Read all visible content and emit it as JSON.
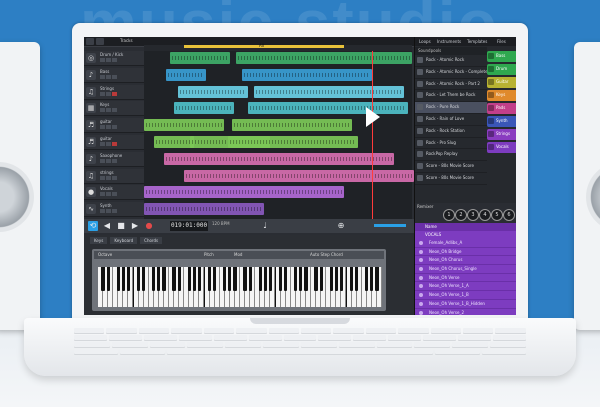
{
  "app": {
    "toolbar_label": "Tracks",
    "ruler_loop_label": "All",
    "tracks": [
      {
        "name": "Drum / Kick",
        "icon": "drums-icon"
      },
      {
        "name": "Bass",
        "icon": "bass-icon"
      },
      {
        "name": "Strings",
        "icon": "strings-icon"
      },
      {
        "name": "Keys",
        "icon": "keys-icon"
      },
      {
        "name": "guitar",
        "icon": "guitar-icon"
      },
      {
        "name": "guitar",
        "icon": "guitar-icon"
      },
      {
        "name": "Saxophone",
        "icon": "sax-icon"
      },
      {
        "name": "strings",
        "icon": "strings-icon"
      },
      {
        "name": "Vocals",
        "icon": "mic-icon"
      },
      {
        "name": "Synth",
        "icon": "synth-icon"
      }
    ]
  },
  "transport": {
    "time": "019:01:000",
    "bpm": "120 BPM"
  },
  "keyboard_panel": {
    "tabs": [
      "Keys",
      "Keyboard",
      "Chords"
    ],
    "controls": [
      "Octave",
      "Pitch",
      "Mod",
      "Auto Step Chord"
    ]
  },
  "sidebar": {
    "tabs": [
      "Loops",
      "Instruments",
      "Templates",
      "Files"
    ],
    "list_header": "Soundpools",
    "items": [
      {
        "label": "Rock - Atomic Rock",
        "selected": false
      },
      {
        "label": "Rock - Atomic Rock - Complete",
        "selected": false
      },
      {
        "label": "Rock - Atomic Rock - Part 2",
        "selected": false
      },
      {
        "label": "Rock - Let Them be Rock",
        "selected": false
      },
      {
        "label": "Rock - Pure Rock",
        "selected": true
      },
      {
        "label": "Rock - Rain of Love",
        "selected": false
      },
      {
        "label": "Rock - Rock Station",
        "selected": false
      },
      {
        "label": "Rock - Pro Slug",
        "selected": false
      },
      {
        "label": "RockPop Replay",
        "selected": false
      },
      {
        "label": "Score - 80s Movie Score",
        "selected": false
      },
      {
        "label": "Score - 80s Movie Score",
        "selected": false
      }
    ],
    "categories": [
      {
        "label": "Bass",
        "color": "#2fa84f"
      },
      {
        "label": "Drum",
        "color": "#2fa84f"
      },
      {
        "label": "Guitar",
        "color": "#b8b232"
      },
      {
        "label": "Keys",
        "color": "#e08a2c"
      },
      {
        "label": "Pads",
        "color": "#c23f8a"
      },
      {
        "label": "Synth",
        "color": "#3a56b8"
      },
      {
        "label": "Strings",
        "color": "#8a3cc0"
      },
      {
        "label": "Vocals",
        "color": "#7d3cc0"
      }
    ],
    "remix": {
      "title": "Remixer",
      "knobs": [
        "1",
        "2",
        "3",
        "4",
        "5",
        "6"
      ]
    },
    "vocals": {
      "header": "VOCALS",
      "column": "Name",
      "items": [
        "Female_Adlibs_A",
        "Neon_Oh Bridge",
        "Neon_Oh Chorus",
        "Neon_Oh Chorus_Single",
        "Neon_Oh Verse",
        "Neon_Oh Verse_1_A",
        "Neon_Oh Verse_1_B",
        "Neon_Oh Verse_1_B_Hidden",
        "Neon_Oh Verse_2"
      ]
    }
  },
  "background_text": "music studio",
  "colors": {
    "background_blue": "#2d7fc4",
    "accent_blue": "#2aa0e6",
    "loop_yellow": "#e8c23a",
    "playhead": "#ff3b3b",
    "vocals_purple": "#7d3cc0"
  }
}
